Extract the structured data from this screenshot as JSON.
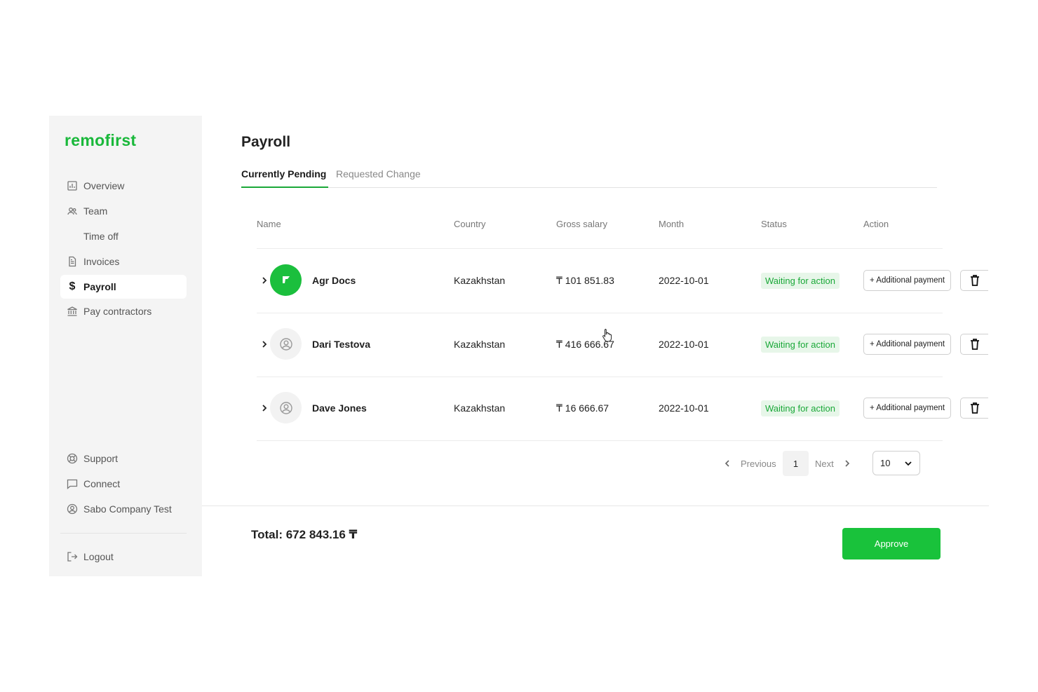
{
  "brand": {
    "logo_text": "remofirst",
    "accent": "#19b83a"
  },
  "sidebar": {
    "items": [
      {
        "label": "Overview",
        "icon": "chart-icon"
      },
      {
        "label": "Team",
        "icon": "users-icon"
      },
      {
        "label": "Time off",
        "icon": ""
      },
      {
        "label": "Invoices",
        "icon": "document-icon"
      },
      {
        "label": "Payroll",
        "icon": "dollar-icon",
        "active": true
      },
      {
        "label": "Pay contractors",
        "icon": "bank-icon"
      }
    ],
    "bottom_items": [
      {
        "label": "Support",
        "icon": "lifebuoy-icon"
      },
      {
        "label": "Connect",
        "icon": "chat-icon"
      },
      {
        "label": "Sabo Company Test",
        "icon": "user-circle-icon"
      }
    ],
    "logout_label": "Logout"
  },
  "main": {
    "title": "Payroll",
    "tabs": [
      {
        "label": "Currently Pending",
        "active": true
      },
      {
        "label": "Requested Change",
        "active": false
      }
    ],
    "columns": [
      "Name",
      "Country",
      "Gross salary",
      "Month",
      "Status",
      "Action"
    ],
    "rows": [
      {
        "name": "Agr Docs",
        "country": "Kazakhstan",
        "gross_salary": "₸ 101 851.83",
        "month": "2022-10-01",
        "status": "Waiting for action",
        "avatar": "logo"
      },
      {
        "name": "Dari Testova",
        "country": "Kazakhstan",
        "gross_salary": "₸ 416 666.67",
        "month": "2022-10-01",
        "status": "Waiting for action",
        "avatar": "placeholder"
      },
      {
        "name": "Dave Jones",
        "country": "Kazakhstan",
        "gross_salary": "₸ 16 666.67",
        "month": "2022-10-01",
        "status": "Waiting for action",
        "avatar": "placeholder"
      }
    ],
    "additional_payment_label": "+ Additional payment",
    "pagination": {
      "previous": "Previous",
      "page": "1",
      "next": "Next",
      "per_page": "10"
    }
  },
  "footer": {
    "total": "Total: 672 843.16 ₸",
    "approve_label": "Approve"
  }
}
